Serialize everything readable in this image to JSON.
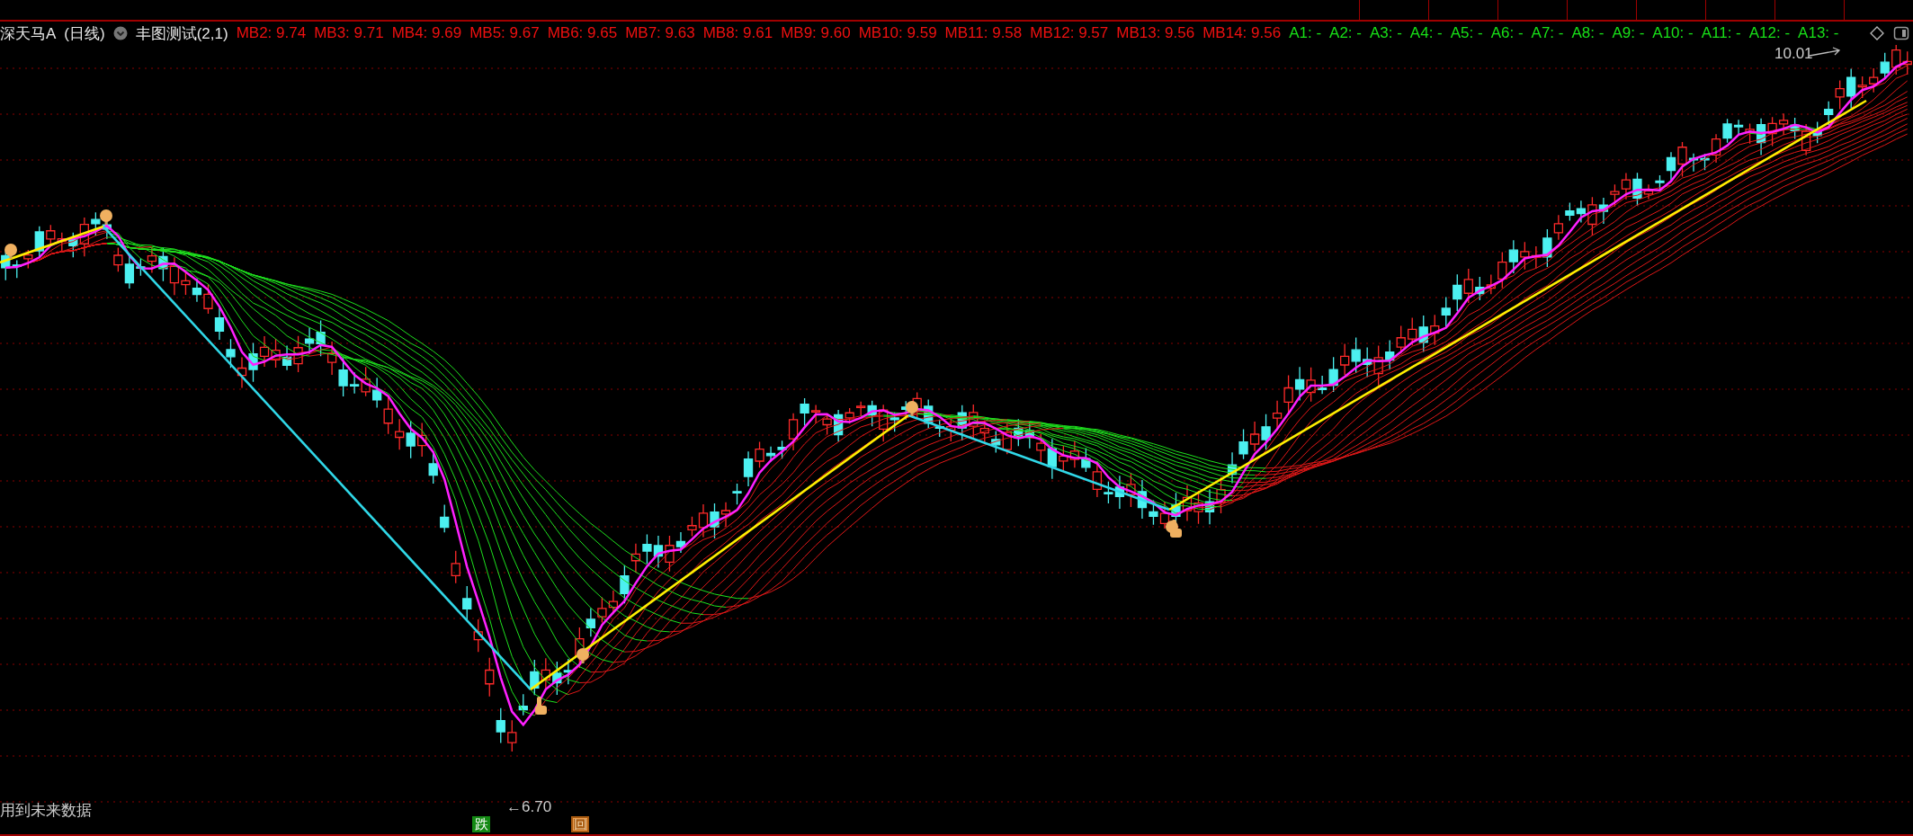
{
  "stock": {
    "name": "深天马A",
    "period": "(日线)"
  },
  "indicator": {
    "name": "丰图测试(2,1)"
  },
  "mb_values": [
    {
      "label": "MB2:",
      "value": "9.74"
    },
    {
      "label": "MB3:",
      "value": "9.71"
    },
    {
      "label": "MB4:",
      "value": "9.69"
    },
    {
      "label": "MB5:",
      "value": "9.67"
    },
    {
      "label": "MB6:",
      "value": "9.65"
    },
    {
      "label": "MB7:",
      "value": "9.63"
    },
    {
      "label": "MB8:",
      "value": "9.61"
    },
    {
      "label": "MB9:",
      "value": "9.60"
    },
    {
      "label": "MB10:",
      "value": "9.59"
    },
    {
      "label": "MB11:",
      "value": "9.58"
    },
    {
      "label": "MB12:",
      "value": "9.57"
    },
    {
      "label": "MB13:",
      "value": "9.56"
    },
    {
      "label": "MB14:",
      "value": "9.56"
    }
  ],
  "a_values": [
    {
      "label": "A1:",
      "value": "-"
    },
    {
      "label": "A2:",
      "value": "-"
    },
    {
      "label": "A3:",
      "value": "-"
    },
    {
      "label": "A4:",
      "value": "-"
    },
    {
      "label": "A5:",
      "value": "-"
    },
    {
      "label": "A6:",
      "value": "-"
    },
    {
      "label": "A7:",
      "value": "-"
    },
    {
      "label": "A8:",
      "value": "-"
    },
    {
      "label": "A9:",
      "value": "-"
    },
    {
      "label": "A10:",
      "value": "-"
    },
    {
      "label": "A11:",
      "value": "-"
    },
    {
      "label": "A12:",
      "value": "-"
    },
    {
      "label": "A13:",
      "value": "-"
    }
  ],
  "chart": {
    "high_label": "10.01",
    "low_label": "←6.70",
    "note": "用到未来数据",
    "markers": [
      {
        "kind": "fall",
        "text": "跌"
      },
      {
        "kind": "return",
        "text": "回"
      }
    ]
  }
}
